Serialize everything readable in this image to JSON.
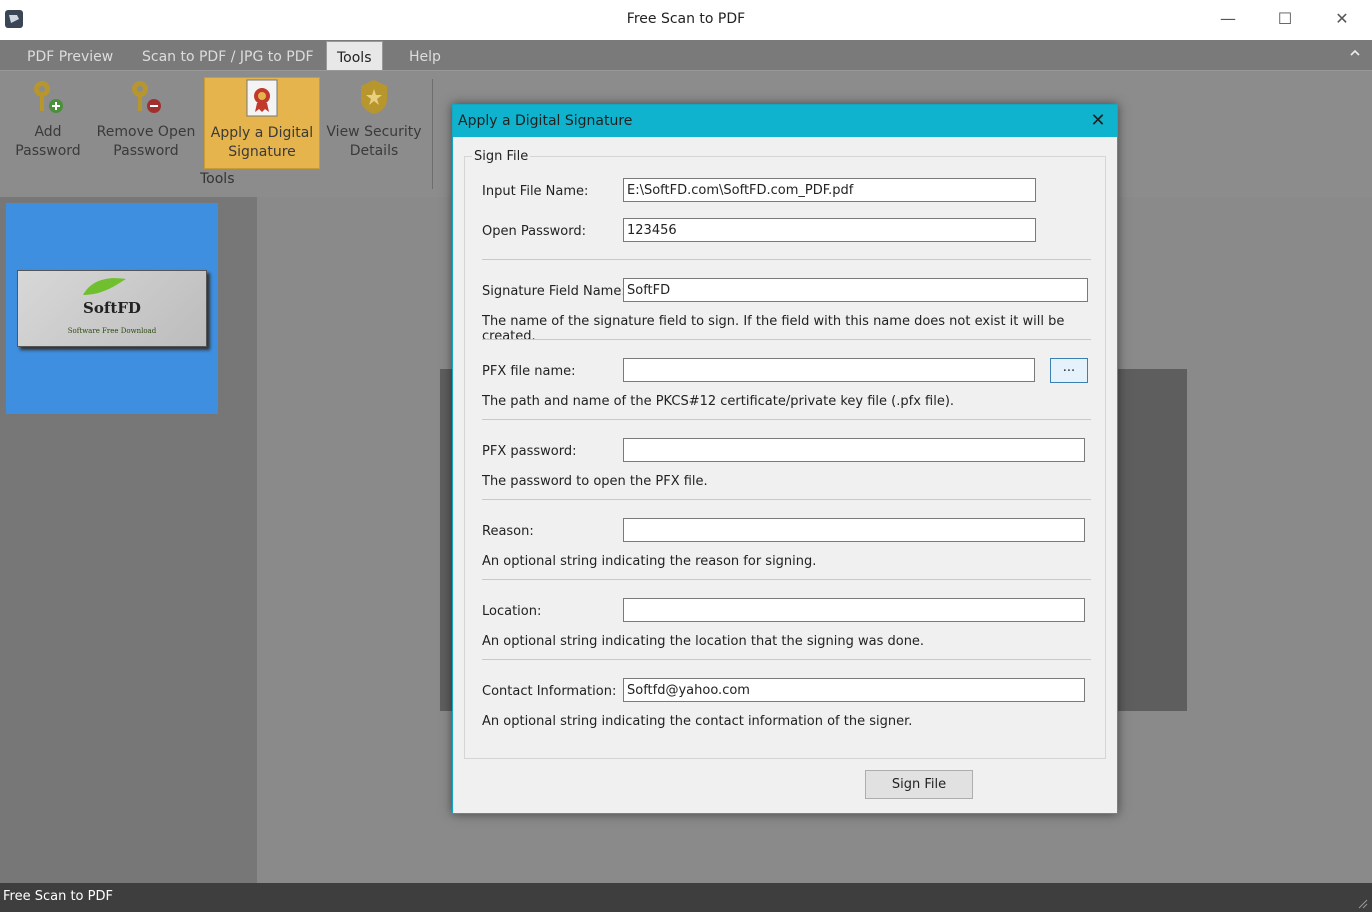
{
  "window": {
    "title": "Free Scan to PDF",
    "minimize": "—",
    "maximize": "☐",
    "close": "✕"
  },
  "ribbon": {
    "tabs": [
      {
        "label": "PDF Preview"
      },
      {
        "label": "Scan to PDF / JPG to PDF"
      },
      {
        "label": "Tools",
        "active": true
      },
      {
        "label": "Help"
      }
    ],
    "buttons": [
      {
        "line1": "Add",
        "line2": "Password",
        "icon": "key-add-icon"
      },
      {
        "line1": "Remove Open",
        "line2": "Password",
        "icon": "key-remove-icon"
      },
      {
        "line1": "Apply a Digital",
        "line2": "Signature",
        "icon": "certificate-icon",
        "selected": true
      },
      {
        "line1": "View Security",
        "line2": "Details",
        "icon": "badge-icon"
      }
    ],
    "group_label": "Tools",
    "collapse_icon": "chevron-up-icon"
  },
  "thumbnail": {
    "logo_text": "SoftFD",
    "logo_sub": "Software Free Download"
  },
  "status": {
    "text": "Free Scan to PDF"
  },
  "dialog": {
    "title": "Apply a Digital Signature",
    "group_label": "Sign File",
    "input_file_label": "Input File Name:",
    "input_file_value": "E:\\SoftFD.com\\SoftFD.com_PDF.pdf",
    "open_password_label": "Open Password:",
    "open_password_value": "123456",
    "sig_field_label": "Signature Field Name:",
    "sig_field_value": "SoftFD",
    "sig_field_desc": "The name of the signature field to sign. If the field with this name does not exist it will be created.",
    "pfx_label": "PFX file name:",
    "pfx_value": "",
    "browse_label": "...",
    "pfx_desc": "The path and name of the PKCS#12 certificate/private key file (.pfx file).",
    "pfx_pw_label": "PFX password:",
    "pfx_pw_value": "",
    "pfx_pw_desc": "The password to open the PFX file.",
    "reason_label": "Reason:",
    "reason_value": "",
    "reason_desc": "An optional string indicating the reason for signing.",
    "location_label": "Location:",
    "location_value": "",
    "location_desc": "An optional string indicating the location that the signing was done.",
    "contact_label": "Contact Information:",
    "contact_value": "Softfd@yahoo.com",
    "contact_desc": "An optional string indicating the contact information of the signer.",
    "sign_button": "Sign File"
  }
}
